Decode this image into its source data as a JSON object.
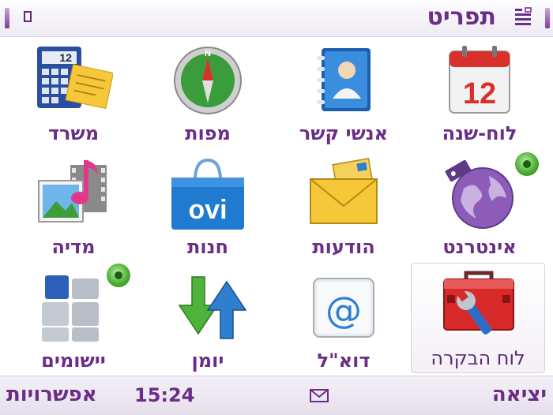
{
  "header": {
    "title": "תפריט",
    "indicator_icon": "square-indicator-icon",
    "menu_icon": "menu-grid-icon"
  },
  "apps": [
    {
      "label": "לוח-שנה",
      "icon": "calendar-icon",
      "calendar_day": "12",
      "selected": false,
      "badge": false
    },
    {
      "label": "אנשי קשר",
      "icon": "contacts-icon",
      "selected": false,
      "badge": false
    },
    {
      "label": "מפות",
      "icon": "compass-icon",
      "compass_letter": "N",
      "selected": false,
      "badge": false
    },
    {
      "label": "משרד",
      "icon": "office-icon",
      "calculator_display": "12",
      "selected": false,
      "badge": false
    },
    {
      "label": "אינטרנט",
      "icon": "globe-icon",
      "selected": false,
      "badge": true
    },
    {
      "label": "הודעות",
      "icon": "envelope-icon",
      "selected": false,
      "badge": false
    },
    {
      "label": "חנות",
      "icon": "ovi-store-icon",
      "store_logo": "ovi",
      "selected": false,
      "badge": false
    },
    {
      "label": "מדיה",
      "icon": "media-icon",
      "selected": false,
      "badge": false
    },
    {
      "label": "לוח הבקרה",
      "icon": "toolbox-icon",
      "selected": true,
      "badge": false
    },
    {
      "label": "דוא\"ל",
      "icon": "email-at-icon",
      "selected": false,
      "badge": false
    },
    {
      "label": "יומן",
      "icon": "log-arrows-icon",
      "selected": false,
      "badge": false
    },
    {
      "label": "יישומים",
      "icon": "applications-icon",
      "selected": false,
      "badge": true
    }
  ],
  "footer": {
    "left_softkey": "אפשרויות",
    "clock": "15:24",
    "message_icon": "envelope-small-icon",
    "right_softkey": "יציאה"
  },
  "colors": {
    "accent": "#6b2d86",
    "badge": "#4faf36"
  }
}
